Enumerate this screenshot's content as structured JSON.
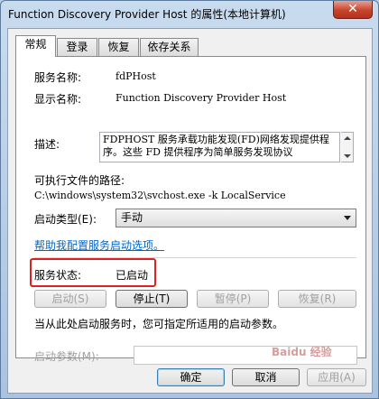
{
  "window": {
    "title": "Function Discovery Provider Host 的属性(本地计算机)",
    "close_glyph": "✕"
  },
  "tabs": [
    {
      "label": "常规",
      "active": true
    },
    {
      "label": "登录",
      "active": false
    },
    {
      "label": "恢复",
      "active": false
    },
    {
      "label": "依存关系",
      "active": false
    }
  ],
  "general": {
    "service_name_label": "服务名称:",
    "service_name_value": "fdPHost",
    "display_name_label": "显示名称:",
    "display_name_value": "Function Discovery Provider Host",
    "description_label": "描述:",
    "description_value": "FDPHOST 服务承载功能发现(FD)网络发现提供程序。这些 FD 提供程序为简单服务发现协议",
    "exe_path_label": "可执行文件的路径:",
    "exe_path_value": "C:\\windows\\system32\\svchost.exe -k LocalService",
    "startup_type_label": "启动类型(E):",
    "startup_type_value": "手动",
    "help_link": "帮助我配置服务启动选项。",
    "status_label": "服务状态:",
    "status_value": "已启动"
  },
  "service_buttons": {
    "start": "启动(S)",
    "stop": "停止(T)",
    "pause": "暂停(P)",
    "resume": "恢复(R)"
  },
  "params": {
    "hint": "当从此处启动服务时，您可指定所适用的启动参数。",
    "label": "启动参数(M):",
    "value": ""
  },
  "footer": {
    "ok": "确定",
    "cancel": "取消",
    "apply": "应用(A)"
  },
  "watermark": "Baidu 经验",
  "colors": {
    "highlight_border": "#e02020",
    "link": "#0066cc"
  }
}
